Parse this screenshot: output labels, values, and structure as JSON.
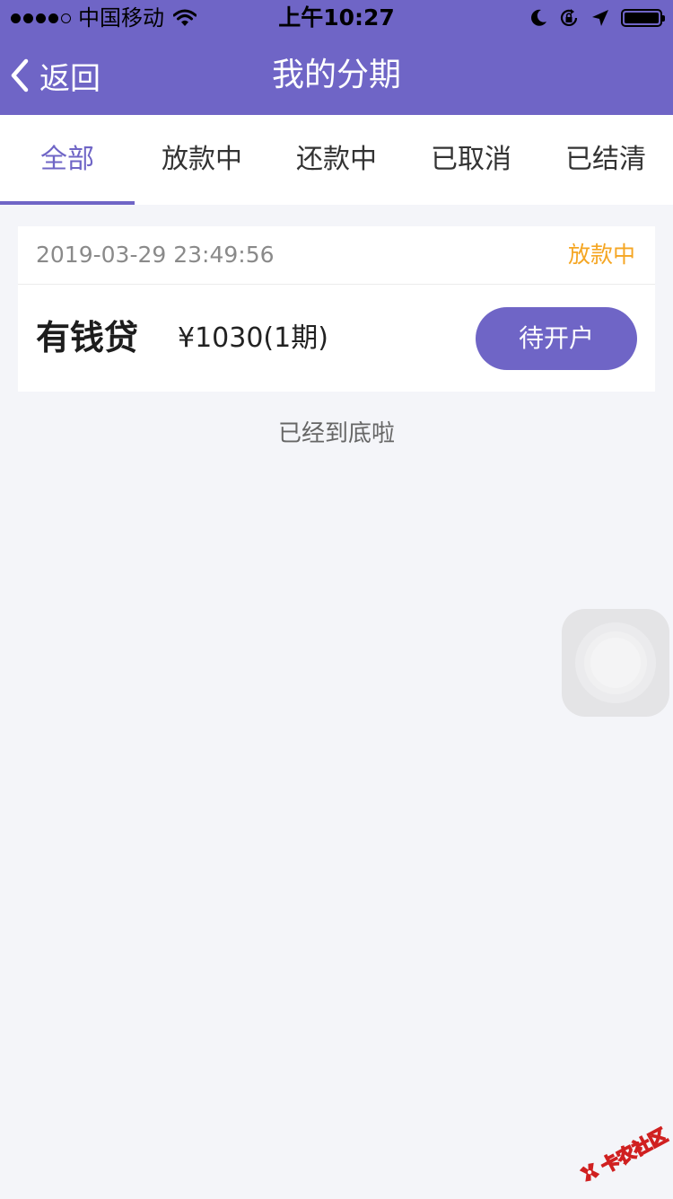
{
  "status_bar": {
    "carrier": "中国移动",
    "time": "上午10:27"
  },
  "nav": {
    "back_label": "返回",
    "title": "我的分期"
  },
  "tabs": [
    {
      "label": "全部",
      "active": true
    },
    {
      "label": "放款中",
      "active": false
    },
    {
      "label": "还款中",
      "active": false
    },
    {
      "label": "已取消",
      "active": false
    },
    {
      "label": "已结清",
      "active": false
    }
  ],
  "orders": [
    {
      "date": "2019-03-29 23:49:56",
      "status": "放款中",
      "product": "有钱贷",
      "amount": "¥1030(1期)",
      "action": "待开户"
    }
  ],
  "end_text": "已经到底啦",
  "watermark": "卡农社区",
  "colors": {
    "primary": "#6f65c6",
    "status_pending": "#f5a623",
    "background": "#f4f5f9"
  }
}
